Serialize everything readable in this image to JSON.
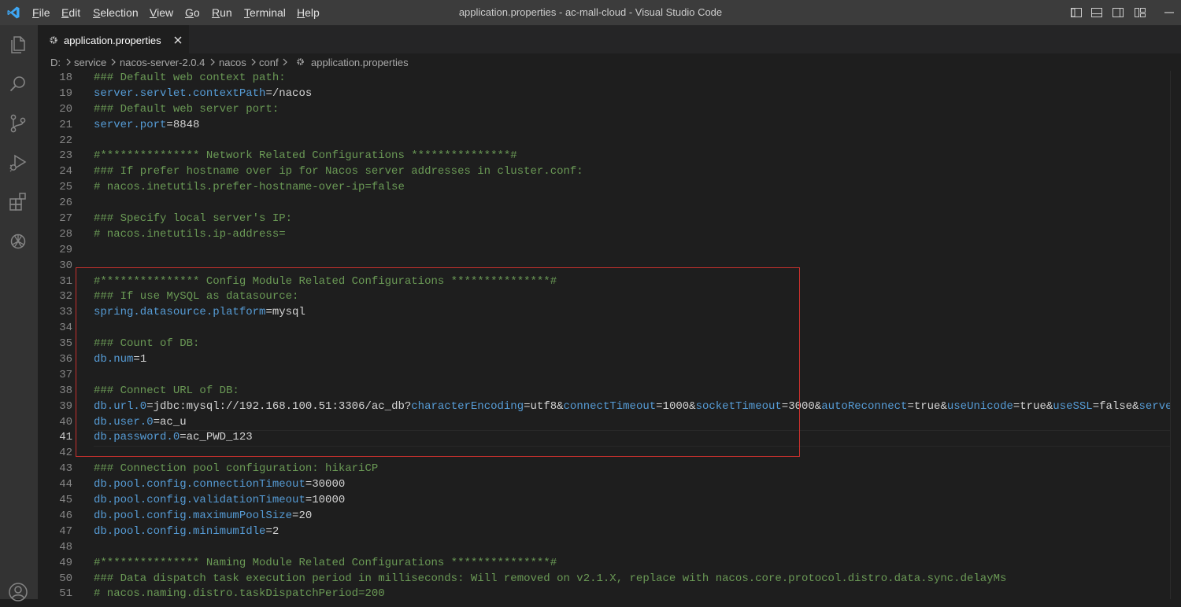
{
  "window": {
    "title": "application.properties - ac-mall-cloud - Visual Studio Code"
  },
  "menu": [
    {
      "label": "File",
      "mnemonic": "F",
      "rest": "ile"
    },
    {
      "label": "Edit",
      "mnemonic": "E",
      "rest": "dit"
    },
    {
      "label": "Selection",
      "mnemonic": "S",
      "rest": "election"
    },
    {
      "label": "View",
      "mnemonic": "V",
      "rest": "iew"
    },
    {
      "label": "Go",
      "mnemonic": "G",
      "rest": "o"
    },
    {
      "label": "Run",
      "mnemonic": "R",
      "rest": "un"
    },
    {
      "label": "Terminal",
      "mnemonic": "T",
      "rest": "erminal"
    },
    {
      "label": "Help",
      "mnemonic": "H",
      "rest": "elp"
    }
  ],
  "activity_bar": [
    "explorer-icon",
    "search-icon",
    "source-control-icon",
    "run-debug-icon",
    "extensions-icon",
    "chatgpt-icon",
    "account-icon"
  ],
  "tab": {
    "label": "application.properties",
    "icon": "gear-icon"
  },
  "breadcrumb": [
    "D:",
    "service",
    "nacos-server-2.0.4",
    "nacos",
    "conf",
    "application.properties"
  ],
  "editor": {
    "current_line": 41,
    "highlight_lines": [
      31,
      42
    ],
    "lines": [
      {
        "n": "18",
        "seg": [
          [
            "c",
            "### Default web context path:"
          ]
        ]
      },
      {
        "n": "19",
        "seg": [
          [
            "k",
            "server.servlet.contextPath"
          ],
          [
            "v",
            "=/nacos"
          ]
        ]
      },
      {
        "n": "20",
        "seg": [
          [
            "c",
            "### Default web server port:"
          ]
        ]
      },
      {
        "n": "21",
        "seg": [
          [
            "k",
            "server.port"
          ],
          [
            "v",
            "=8848"
          ]
        ]
      },
      {
        "n": "22",
        "seg": []
      },
      {
        "n": "23",
        "seg": [
          [
            "c",
            "#*************** Network Related Configurations ***************#"
          ]
        ]
      },
      {
        "n": "24",
        "seg": [
          [
            "c",
            "### If prefer hostname over ip for Nacos server addresses in cluster.conf:"
          ]
        ]
      },
      {
        "n": "25",
        "seg": [
          [
            "c",
            "# nacos.inetutils.prefer-hostname-over-ip=false"
          ]
        ]
      },
      {
        "n": "26",
        "seg": []
      },
      {
        "n": "27",
        "seg": [
          [
            "c",
            "### Specify local server's IP:"
          ]
        ]
      },
      {
        "n": "28",
        "seg": [
          [
            "c",
            "# nacos.inetutils.ip-address="
          ]
        ]
      },
      {
        "n": "29",
        "seg": []
      },
      {
        "n": "30",
        "seg": []
      },
      {
        "n": "31",
        "seg": [
          [
            "c",
            "#*************** Config Module Related Configurations ***************#"
          ]
        ]
      },
      {
        "n": "32",
        "seg": [
          [
            "c",
            "### If use MySQL as datasource:"
          ]
        ]
      },
      {
        "n": "33",
        "seg": [
          [
            "k",
            "spring.datasource.platform"
          ],
          [
            "v",
            "=mysql"
          ]
        ]
      },
      {
        "n": "34",
        "seg": []
      },
      {
        "n": "35",
        "seg": [
          [
            "c",
            "### Count of DB:"
          ]
        ]
      },
      {
        "n": "36",
        "seg": [
          [
            "k",
            "db.num"
          ],
          [
            "v",
            "=1"
          ]
        ]
      },
      {
        "n": "37",
        "seg": []
      },
      {
        "n": "38",
        "seg": [
          [
            "c",
            "### Connect URL of DB:"
          ]
        ]
      },
      {
        "n": "39",
        "seg": [
          [
            "k",
            "db.url.0"
          ],
          [
            "v",
            "=jdbc:mysql://192.168.100.51:3306/ac_db?"
          ],
          [
            "k",
            "characterEncoding"
          ],
          [
            "v",
            "=utf8&"
          ],
          [
            "k",
            "connectTimeout"
          ],
          [
            "v",
            "=1000&"
          ],
          [
            "k",
            "socketTimeout"
          ],
          [
            "v",
            "=3000&"
          ],
          [
            "k",
            "autoReconnect"
          ],
          [
            "v",
            "=true&"
          ],
          [
            "k",
            "useUnicode"
          ],
          [
            "v",
            "=true&"
          ],
          [
            "k",
            "useSSL"
          ],
          [
            "v",
            "=false&"
          ],
          [
            "k",
            "serverTimezone"
          ]
        ]
      },
      {
        "n": "40",
        "seg": [
          [
            "k",
            "db.user.0"
          ],
          [
            "v",
            "=ac_u"
          ]
        ]
      },
      {
        "n": "41",
        "seg": [
          [
            "k",
            "db.password.0"
          ],
          [
            "v",
            "=ac_PWD_123"
          ]
        ]
      },
      {
        "n": "42",
        "seg": []
      },
      {
        "n": "43",
        "seg": [
          [
            "c",
            "### Connection pool configuration: hikariCP"
          ]
        ]
      },
      {
        "n": "44",
        "seg": [
          [
            "k",
            "db.pool.config.connectionTimeout"
          ],
          [
            "v",
            "=30000"
          ]
        ]
      },
      {
        "n": "45",
        "seg": [
          [
            "k",
            "db.pool.config.validationTimeout"
          ],
          [
            "v",
            "=10000"
          ]
        ]
      },
      {
        "n": "46",
        "seg": [
          [
            "k",
            "db.pool.config.maximumPoolSize"
          ],
          [
            "v",
            "=20"
          ]
        ]
      },
      {
        "n": "47",
        "seg": [
          [
            "k",
            "db.pool.config.minimumIdle"
          ],
          [
            "v",
            "=2"
          ]
        ]
      },
      {
        "n": "48",
        "seg": []
      },
      {
        "n": "49",
        "seg": [
          [
            "c",
            "#*************** Naming Module Related Configurations ***************#"
          ]
        ]
      },
      {
        "n": "50",
        "seg": [
          [
            "c",
            "### Data dispatch task execution period in milliseconds: Will removed on v2.1.X, replace with nacos.core.protocol.distro.data.sync.delayMs"
          ]
        ]
      },
      {
        "n": "51",
        "seg": [
          [
            "c",
            "# nacos.naming.distro.taskDispatchPeriod=200"
          ]
        ]
      }
    ]
  },
  "colors": {
    "comment": "#6a9955",
    "key": "#569cd6",
    "value": "#d4d4d4",
    "highlight_border": "#c8312d",
    "vscode_blue": "#0078d4"
  }
}
